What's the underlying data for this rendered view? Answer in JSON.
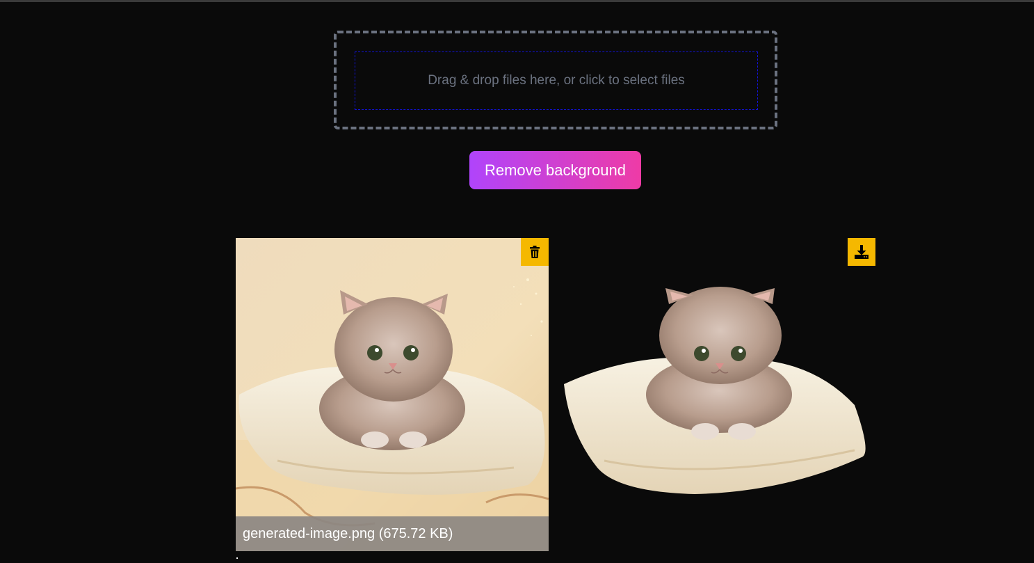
{
  "dropzone": {
    "text": "Drag & drop files here, or click to select files"
  },
  "actions": {
    "remove_background_label": "Remove background"
  },
  "original": {
    "caption": "generated-image.png (675.72 KB)",
    "delete_icon": "trash-icon"
  },
  "result": {
    "download_icon": "download-icon"
  },
  "colors": {
    "background": "#0a0a0a",
    "gradient_start": "#b044fb",
    "gradient_end": "#ee3ba6",
    "icon_button": "#f5b800",
    "dropzone_border": "#6b7280",
    "dropzone_inner_border": "#1212d8"
  }
}
